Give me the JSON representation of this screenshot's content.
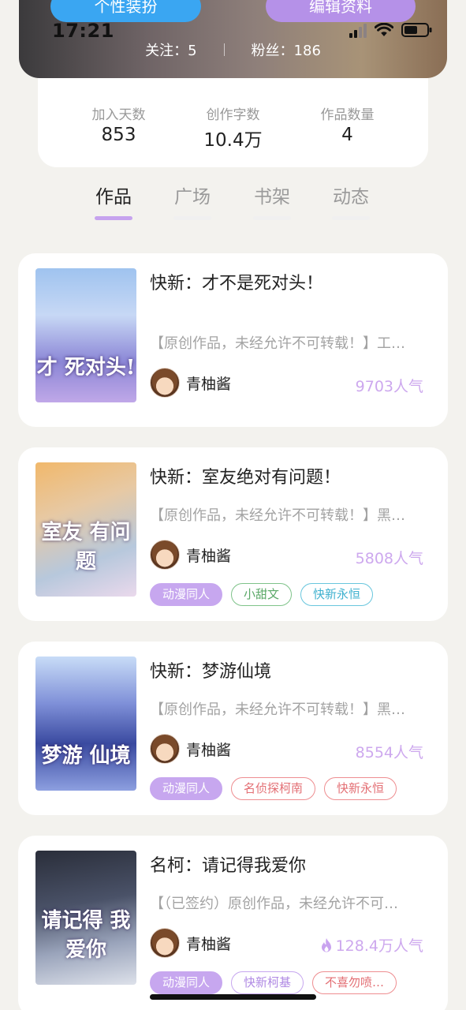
{
  "header": {
    "dress_button": "个性装扮",
    "edit_button": "编辑资料",
    "status_time": "17:21",
    "following_label": "关注：",
    "following_value": "5",
    "fans_label": "粉丝：",
    "fans_value": "186"
  },
  "stats": [
    {
      "label": "加入天数",
      "value": "853"
    },
    {
      "label": "创作字数",
      "value": "10.4万"
    },
    {
      "label": "作品数量",
      "value": "4"
    }
  ],
  "tabs": [
    {
      "label": "作品",
      "active": true
    },
    {
      "label": "广场",
      "active": false
    },
    {
      "label": "书架",
      "active": false
    },
    {
      "label": "动态",
      "active": false
    }
  ],
  "works": [
    {
      "title": "快新：才不是死对头！",
      "description": "【原创作品，未经允许不可转载！】工…",
      "author": "青柚酱",
      "popularity": "9703人气",
      "cover_text": "才 死对头!",
      "tags": []
    },
    {
      "title": "快新：室友绝对有问题！",
      "description": "【原创作品，未经允许不可转载！】黑…",
      "author": "青柚酱",
      "popularity": "5808人气",
      "cover_text": "室友 有问题",
      "tags": [
        "动漫同人",
        "小甜文",
        "快新永恒"
      ]
    },
    {
      "title": "快新：梦游仙境",
      "description": "【原创作品，未经允许不可转载！】黑…",
      "author": "青柚酱",
      "popularity": "8554人气",
      "cover_text": "梦游 仙境",
      "tags": [
        "动漫同人",
        "名侦探柯南",
        "快新永恒"
      ]
    },
    {
      "title": "名柯：请记得我爱你",
      "description": "【（已签约）原创作品，未经允许不可…",
      "author": "青柚酱",
      "popularity": "128.4万人气",
      "cover_text": "请记得 我爱你",
      "tags": [
        "动漫同人",
        "快新柯基",
        "不喜勿喷…"
      ]
    }
  ],
  "colors": {
    "accent_purple": "#c7a7ef",
    "dress_blue": "#3aa6f2",
    "popularity_purple": "#cda8ee"
  }
}
